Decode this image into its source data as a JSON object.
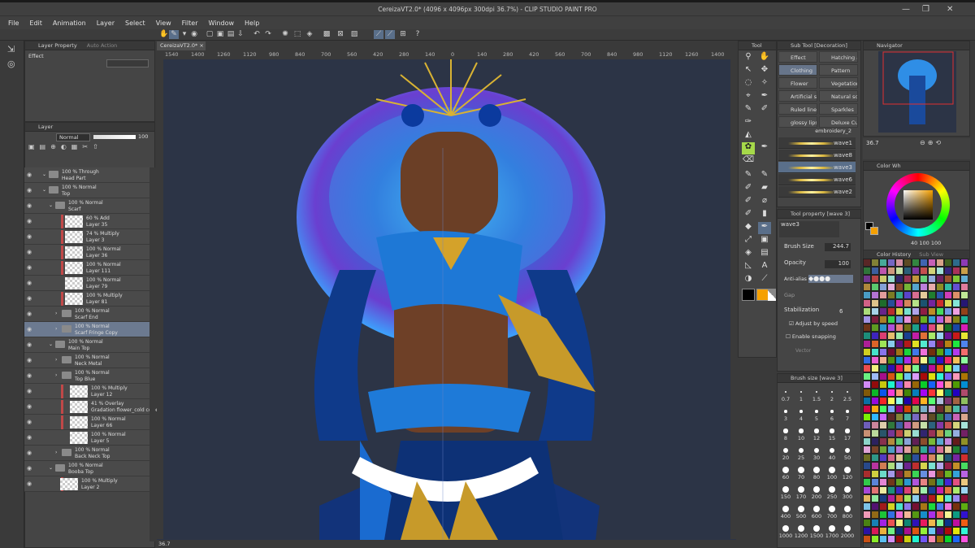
{
  "window": {
    "title": "CereizaVT2.0* (4096 x 4096px 300dpi 36.7%)  - CLIP STUDIO PAINT PRO"
  },
  "menu": [
    "File",
    "Edit",
    "Animation",
    "Layer",
    "Select",
    "View",
    "Filter",
    "Window",
    "Help"
  ],
  "left_panel": {
    "tab_layer_property": "Layer Property",
    "tab_auto_action": "Auto Action",
    "effect_label": "Effect",
    "layer_tab": "Layer",
    "blend_mode": "Normal",
    "opacity": "100"
  },
  "layers": [
    {
      "l1": "100 % Through",
      "l2": "Head Part",
      "type": "folder",
      "indent": 0,
      "red": false
    },
    {
      "l1": "100 % Normal",
      "l2": "Top",
      "type": "folder",
      "indent": 0,
      "red": false
    },
    {
      "l1": "100 % Normal",
      "l2": "Scarf",
      "type": "folder",
      "indent": 1,
      "red": false
    },
    {
      "l1": "60 % Add",
      "l2": "Layer 35",
      "type": "layer",
      "indent": 2,
      "red": true
    },
    {
      "l1": "74 % Multiply",
      "l2": "Layer 3",
      "type": "layer",
      "indent": 2,
      "red": true
    },
    {
      "l1": "100 % Normal",
      "l2": "Layer 36",
      "type": "layer",
      "indent": 2,
      "red": true
    },
    {
      "l1": "100 % Normal",
      "l2": "Layer 111",
      "type": "layer",
      "indent": 2,
      "red": true
    },
    {
      "l1": "100 % Normal",
      "l2": "Layer 79",
      "type": "layer",
      "indent": 2,
      "red": false
    },
    {
      "l1": "100 % Multiply",
      "l2": "Layer 81",
      "type": "layer",
      "indent": 2,
      "red": true
    },
    {
      "l1": "100 % Normal",
      "l2": "Scarf End",
      "type": "folder",
      "indent": 2,
      "red": false
    },
    {
      "l1": "100 % Normal",
      "l2": "Scarf Fringe Copy",
      "type": "folder",
      "indent": 2,
      "red": false,
      "selected": true
    },
    {
      "l1": "100 % Normal",
      "l2": "Main Top",
      "type": "folder",
      "indent": 1,
      "red": false
    },
    {
      "l1": "100 % Normal",
      "l2": "Neck Metal",
      "type": "folder",
      "indent": 2,
      "red": false
    },
    {
      "l1": "100 % Normal",
      "l2": "Top Blue",
      "type": "folder",
      "indent": 2,
      "red": false
    },
    {
      "l1": "100 % Multiply",
      "l2": "Layer 12",
      "type": "layer",
      "indent": 3,
      "red": true
    },
    {
      "l1": "41 % Overlay",
      "l2": "Gradation flower_cold color",
      "type": "layer",
      "indent": 3,
      "red": true
    },
    {
      "l1": "100 % Normal",
      "l2": "Layer 66",
      "type": "layer",
      "indent": 3,
      "red": true
    },
    {
      "l1": "100 % Normal",
      "l2": "Layer 5",
      "type": "layer",
      "indent": 3,
      "red": false
    },
    {
      "l1": "100 % Normal",
      "l2": "Back Neck Top",
      "type": "folder",
      "indent": 2,
      "red": false
    },
    {
      "l1": "100 % Normal",
      "l2": "Booba Top",
      "type": "folder",
      "indent": 1,
      "red": false
    },
    {
      "l1": "100 % Multiply",
      "l2": "Layer 2",
      "type": "layer",
      "indent": 1,
      "red": true
    }
  ],
  "canvas": {
    "doc_tab": "CereizaVT2.0*",
    "zoom_left": "36.7",
    "ruler": [
      "1540",
      "1400",
      "1260",
      "1120",
      "980",
      "840",
      "700",
      "560",
      "420",
      "280",
      "140",
      "0",
      "140",
      "280",
      "420",
      "560",
      "700",
      "840",
      "980",
      "1120",
      "1260",
      "1400"
    ]
  },
  "tool_panel": {
    "title": "Tool"
  },
  "sub_tool": {
    "title": "Sub Tool [Decoration]",
    "items": [
      [
        "Effect",
        "Hatching a"
      ],
      [
        "Clothing",
        "Pattern"
      ],
      [
        "Flower",
        "Vegetation"
      ],
      [
        "Artificial sc",
        "Natural sce"
      ],
      [
        "Ruled line",
        "Sparkles"
      ],
      [
        "glossy lips",
        "Deluxe Cur"
      ]
    ],
    "brushes": [
      "embroidery_2",
      "wave1",
      "wave8",
      "wave3",
      "wave6",
      "wave2"
    ]
  },
  "tool_property": {
    "title": "Tool property [wave 3]",
    "current": "wave3",
    "brush_size_label": "Brush Size",
    "brush_size": "244.7",
    "opacity_label": "Opacity",
    "opacity": "100",
    "antialias_label": "Anti-alias",
    "gap_label": "Gap",
    "stabilization_label": "Stabilization",
    "stabilization": "6",
    "adjust_speed": "Adjust by speed",
    "enable_snapping": "Enable snapping",
    "vector_label": "Vector"
  },
  "brush_size_panel": {
    "title": "Brush size [wave 3]",
    "sizes": [
      "0.7",
      "1",
      "1.5",
      "2",
      "2.5",
      "3",
      "4",
      "5",
      "6",
      "7",
      "8",
      "10",
      "12",
      "15",
      "17",
      "20",
      "25",
      "30",
      "40",
      "50",
      "60",
      "70",
      "80",
      "100",
      "120",
      "150",
      "170",
      "200",
      "250",
      "300",
      "400",
      "500",
      "600",
      "700",
      "800",
      "1000",
      "1200",
      "1500",
      "1700",
      "2000"
    ]
  },
  "navigator": {
    "title": "Navigator",
    "zoom": "36.7"
  },
  "color_wheel": {
    "title": "Color Wh",
    "values": [
      "40",
      "100",
      "100"
    ]
  },
  "color_history": {
    "title": "Color History",
    "tab2": "Sub View"
  },
  "colors": {
    "accent": "#5a6f8a",
    "canvas_bg": "#2c3446",
    "fg_color": "#000000",
    "bg_color": "#f5a000"
  }
}
